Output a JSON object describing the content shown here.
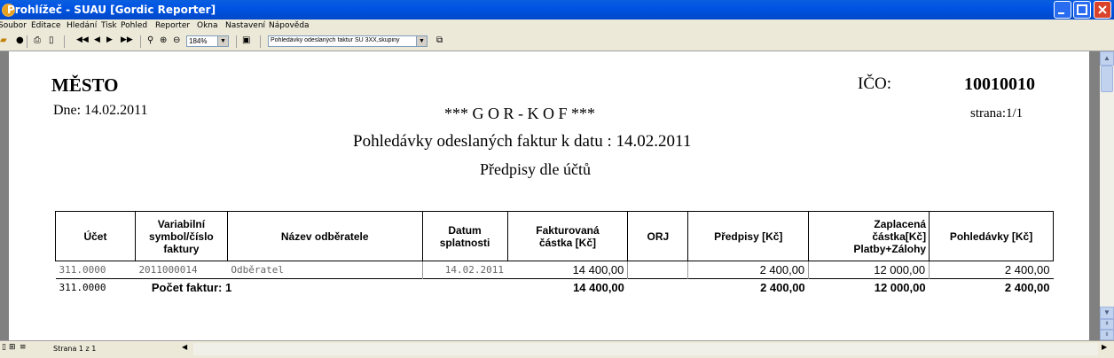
{
  "window": {
    "title": "Prohlížeč - SUAU [Gordic Reporter]"
  },
  "menu": [
    "Soubor",
    "Editace",
    "Hledání",
    "Tisk",
    "Pohled",
    "Reporter",
    "Okna",
    "Nastavení",
    "Nápověda"
  ],
  "toolbar": {
    "zoom_value": "184%",
    "report_value": "Pohledávky odeslaných faktur SU 3XX,skupiny"
  },
  "report": {
    "org": "MĚSTO",
    "ico_label": "IČO:",
    "ico_value": "10010010",
    "date_line": "Dne: 14.02.2011",
    "center_title": "*** G O R - K O F ***",
    "page_line": "strana:1/1",
    "title": "Pohledávky odeslaných faktur k datu : 14.02.2011",
    "subtitle": "Předpisy dle účtů",
    "columns": {
      "ucet": "Účet",
      "vs1": "Variabilní",
      "vs2": "symbol/číslo",
      "vs3": "faktury",
      "nazev": "Název odběratele",
      "datum1": "Datum",
      "datum2": "splatnosti",
      "fakt1": "Fakturovaná",
      "fakt2": "částka [Kč]",
      "orj": "ORJ",
      "predpisy": "Předpisy [Kč]",
      "zap1": "Zaplacená",
      "zap2": "částka[Kč]",
      "zap3": "Platby+Zálohy",
      "pohl": "Pohledávky [Kč]"
    },
    "rows": [
      {
        "ucet": "311.0000",
        "vs": "2011000014",
        "nazev": "Odběratel",
        "datum": "14.02.2011",
        "fakt": "14 400,00",
        "orj": "",
        "predpisy": "2 400,00",
        "zaplaceno": "12 000,00",
        "pohledavky": "2 400,00"
      }
    ],
    "summary": {
      "ucet": "311.0000",
      "count_label": "Počet faktur:",
      "count": "1",
      "fakt": "14 400,00",
      "predpisy": "2 400,00",
      "zaplaceno": "12 000,00",
      "pohledavky": "2 400,00"
    }
  },
  "status": {
    "page": "Strana 1 z 1"
  }
}
